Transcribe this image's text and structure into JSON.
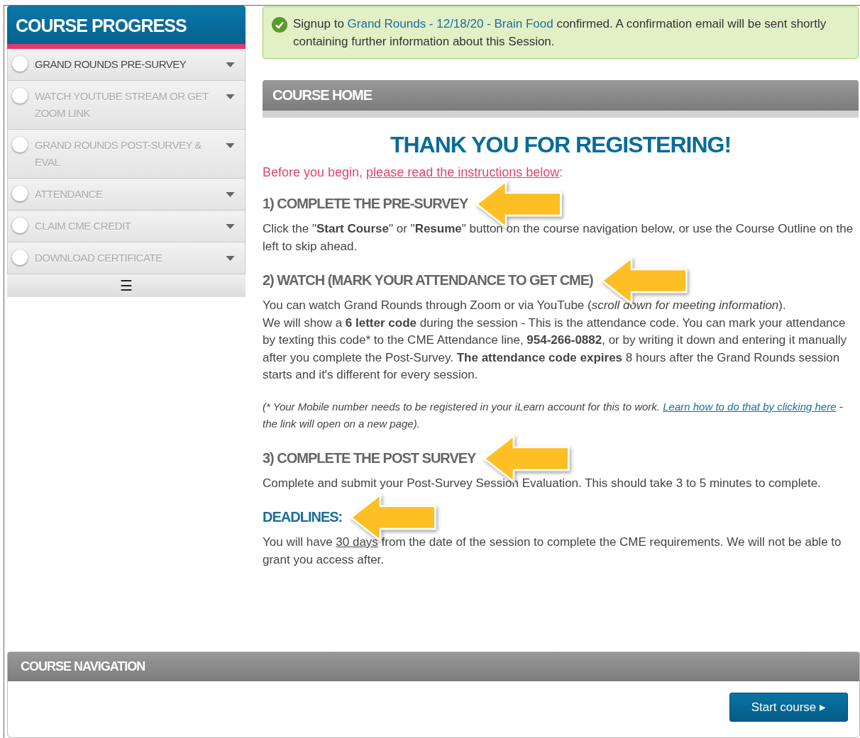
{
  "sidebar": {
    "title": "COURSE PROGRESS",
    "items": [
      {
        "label": "GRAND ROUNDS PRE-SURVEY",
        "disabled": false
      },
      {
        "label": "WATCH YOUTUBE STREAM OR GET ZOOM LINK",
        "disabled": true
      },
      {
        "label": "GRAND ROUNDS POST-SURVEY & EVAL",
        "disabled": true
      },
      {
        "label": "ATTENDANCE",
        "disabled": true
      },
      {
        "label": "CLAIM CME CREDIT",
        "disabled": true
      },
      {
        "label": "DOWNLOAD CERTIFICATE",
        "disabled": true
      }
    ],
    "menu_glyph": "☰"
  },
  "alert": {
    "before": "Signup to ",
    "link": "Grand Rounds - 12/18/20 - Brain Food",
    "after": " confirmed. A confirmation email will be sent shortly containing further information about this Session."
  },
  "course_home": {
    "header": "COURSE HOME",
    "title": "THANK YOU FOR REGISTERING!",
    "intro": {
      "before": "Before you begin, ",
      "link": "please read the instructions below",
      "after": ":"
    },
    "sections": [
      {
        "kind": "step",
        "heading": "1) COMPLETE THE PRE-SURVEY",
        "paragraphs": [
          "Click the \"**Start Course**\" or \"**Resume**\" button on the course navigation below, or use the Course Outline on the left to skip ahead."
        ]
      },
      {
        "kind": "step",
        "heading": "2) WATCH (MARK YOUR ATTENDANCE TO GET CME)",
        "paragraphs": [
          "You can watch Grand Rounds through Zoom or via YouTube (*scroll down for meeting information*).",
          "We will show a **6 letter code** during the session - This is the attendance code. You can mark your attendance by texting this code* to the CME Attendance line, **954-266-0882**, or by writing it down and entering it manually after you complete the Post-Survey. **The attendance code expires** 8 hours after the Grand Rounds session starts and it's different for every session."
        ],
        "note": {
          "before": "(* Your Mobile number needs to be registered in your iLearn account for this to work. ",
          "link": "Learn how to do that by clicking here",
          "after": " - the link will open on a new page)."
        }
      },
      {
        "kind": "step",
        "heading": "3) COMPLETE THE POST SURVEY",
        "paragraphs": [
          "Complete and submit your Post-Survey Session Evaluation. This should take 3 to 5 minutes to complete."
        ]
      },
      {
        "kind": "deadline",
        "heading": "DEADLINES:",
        "underlined_paragraph": {
          "before": "You will have ",
          "underlined": "30 days",
          "after": " from the date of the session to complete the CME requirements. We will not be able to grant you access after."
        }
      }
    ]
  },
  "course_navigation": {
    "header": "COURSE NAVIGATION",
    "button": "Start course",
    "button_glyph": "▸"
  }
}
